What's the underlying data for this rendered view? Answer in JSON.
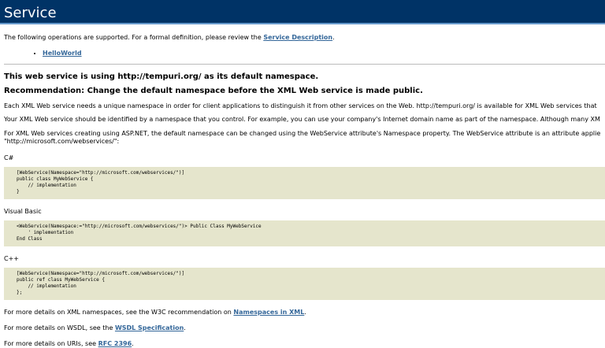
{
  "header": {
    "title": "Service"
  },
  "intro": {
    "text": "The following operations are supported. For a formal definition, please review the ",
    "link": "Service Description",
    "end": "."
  },
  "operations": [
    "HelloWorld"
  ],
  "namespace_notice": {
    "heading": "This web service is using http://tempuri.org/ as its default namespace.",
    "recommendation": "Recommendation: Change the default namespace before the XML Web service is made public.",
    "para1": "Each XML Web service needs a unique namespace in order for client applications to distinguish it from other services on the Web. http://tempuri.org/ is available for XML Web services that",
    "para2": "Your XML Web service should be identified by a namespace that you control. For example, you can use your company's Internet domain name as part of the namespace. Although many XM",
    "para3": "For ASP.NET, the default namespace can be changed using the WebService attribute's Namespace property. The WebService attribute is an attribute applie",
    "para3_line2": "\"http://microsoft.com/webservices/\":",
    "para3_full": "For XML Web services creating using ASP.NET, the default namespace can be changed using the WebService attribute's Namespace property. The WebService attribute is an attribute applie"
  },
  "samples": [
    {
      "language": "C#",
      "code": "[WebService(Namespace=\"http://microsoft.com/webservices/\")]\npublic class MyWebService {\n    // implementation\n}"
    },
    {
      "language": "Visual Basic",
      "code": "<WebService(Namespace:=\"http://microsoft.com/webservices/\")> Public Class MyWebService\n    ' implementation\nEnd Class"
    },
    {
      "language": "C++",
      "code": "[WebService(Namespace=\"http://microsoft.com/webservices/\")]\npublic ref class MyWebService {\n    // implementation\n};"
    }
  ],
  "footer": [
    {
      "text": "For more details on XML namespaces, see the W3C recommendation on ",
      "link": "Namespaces in XML",
      "end": "."
    },
    {
      "text": "For more details on WSDL, see the ",
      "link": "WSDL Specification",
      "end": "."
    },
    {
      "text": "For more details on URIs, see ",
      "link": "RFC 2396",
      "end": "."
    }
  ]
}
